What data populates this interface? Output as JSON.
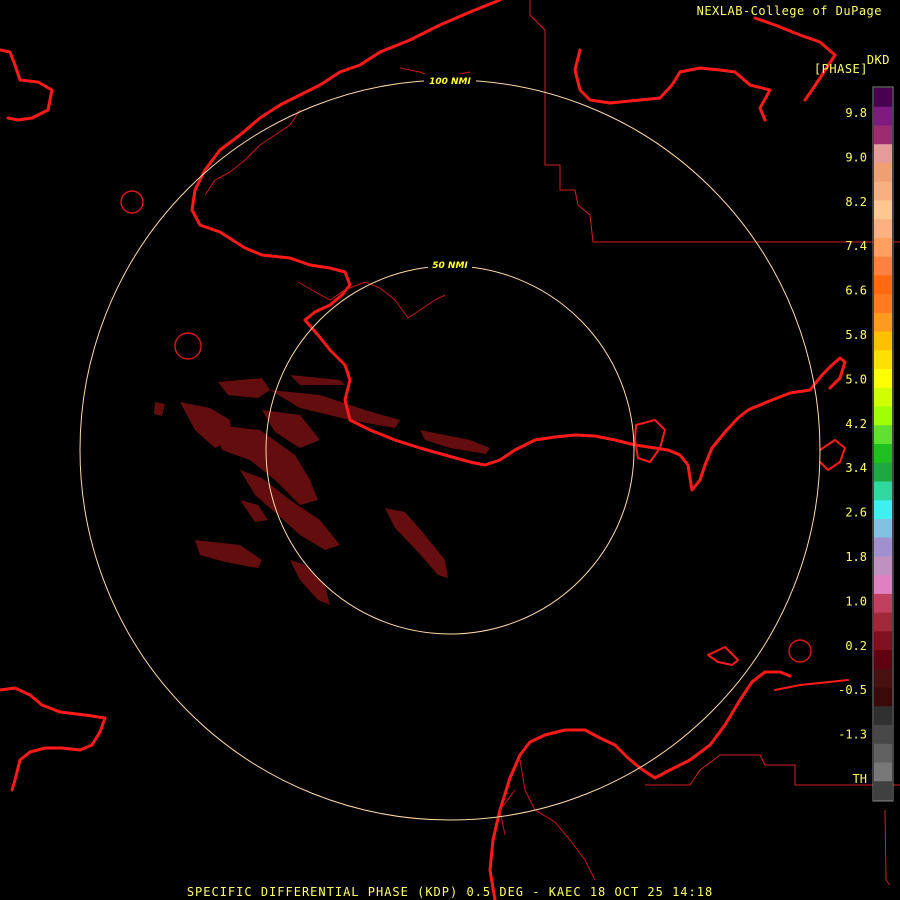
{
  "header": {
    "credit": "NEXLAB-College of DuPage",
    "product_code": "DKD",
    "product_unit": "[PHASE]"
  },
  "footer": {
    "caption": "SPECIFIC DIFFERENTIAL PHASE (KDP) 0.5 DEG - KAEC 18 OCT 25 14:18"
  },
  "range_rings": {
    "inner_label": "50 NMI",
    "outer_label": "100 NMI",
    "color": "#ffd9a8"
  },
  "colors": {
    "coastline": "#ff1a1a",
    "boundary": "#d42020",
    "echo": "#6a0e10",
    "label_text": "#ffff66"
  },
  "legend": {
    "tick_labels": [
      "9.8",
      "9.0",
      "8.2",
      "7.4",
      "6.6",
      "5.8",
      "5.0",
      "4.2",
      "3.4",
      "2.6",
      "1.8",
      "1.0",
      "0.2",
      "-0.5",
      "-1.3",
      "TH"
    ],
    "colors": [
      "#4a0050",
      "#801a80",
      "#9a2d70",
      "#e89a9a",
      "#f0a070",
      "#f8b080",
      "#ffc890",
      "#ffb080",
      "#ffa060",
      "#ff8040",
      "#ff6a10",
      "#ff7a20",
      "#ff9a20",
      "#ffc000",
      "#ffe000",
      "#ffff00",
      "#d0ff00",
      "#a0ff00",
      "#60e030",
      "#20c020",
      "#20a840",
      "#30d8a0",
      "#40f0f0",
      "#80c0e0",
      "#a090d0",
      "#c090c0",
      "#e080c0",
      "#c04060",
      "#a02838",
      "#801020",
      "#600010",
      "#481010",
      "#3a0a0a",
      "#303030",
      "#484848",
      "#606060",
      "#787878",
      "#404040"
    ]
  }
}
